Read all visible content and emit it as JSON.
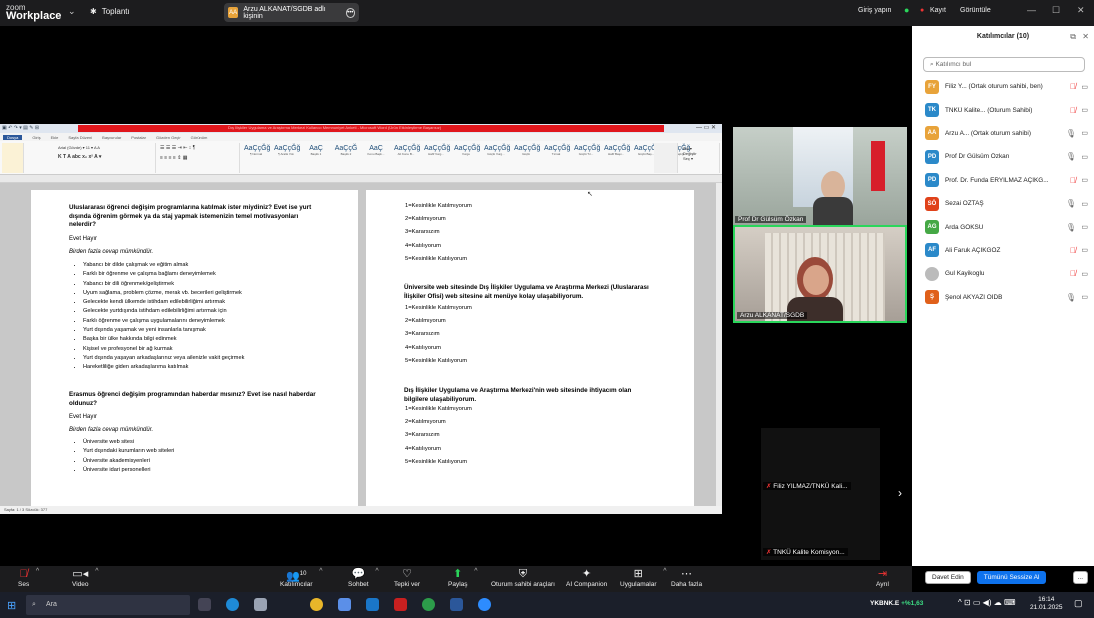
{
  "zoom": {
    "brand_line1": "zoom",
    "brand_line2": "Workplace",
    "meetings": "Toplantı",
    "share_pill": "Arzu ALKANAT/SGDB adlı kişinin",
    "share_initials": "AA",
    "sign_in": "Giriş yapın",
    "record": "Kayıt",
    "view": "Görüntüle"
  },
  "document": {
    "title": "Dış İlişkiler Uygulama ve Araştırma Merkezi Kullanıcı Memnuniyet Anketi - Microsoft Word (Ürün Etkinleştirme Başarısız)",
    "tabs": [
      "Dosya",
      "Giriş",
      "Ekle",
      "Sayfa Düzeni",
      "Başvurular",
      "Postalar",
      "Gözden Geçir",
      "Görünüm"
    ],
    "styles": [
      {
        "sample": "AaÇçĞğ",
        "name": "¶ Normal"
      },
      {
        "sample": "AaÇçĞğ",
        "name": "¶ Aralık Yok"
      },
      {
        "sample": "AaÇ",
        "name": "Başlık 1"
      },
      {
        "sample": "AaÇçĞ",
        "name": "Başlık 2"
      },
      {
        "sample": "AaÇ",
        "name": "Konu Başlı..."
      },
      {
        "sample": "AaÇçĞğ",
        "name": "Alt Konu B..."
      },
      {
        "sample": "AaÇçĞğ",
        "name": "Hafif Vurg..."
      },
      {
        "sample": "AaÇçĞğ",
        "name": "Vurgu"
      },
      {
        "sample": "AaÇçĞğ",
        "name": "Güçlü Vurg..."
      },
      {
        "sample": "AaÇçĞğ",
        "name": "Güçlü"
      },
      {
        "sample": "AaÇçĞğ",
        "name": "Tırnak"
      },
      {
        "sample": "AaÇçĞğ",
        "name": "Güçlü Tır..."
      },
      {
        "sample": "AaÇçĞğ",
        "name": "Hafif Başv..."
      },
      {
        "sample": "AaÇçĞğ",
        "name": "Güçlü Baş..."
      },
      {
        "sample": "AaÇçĞğ",
        "name": "Kitap Başlığı"
      }
    ],
    "status": "Sayfa: 1 / 3   Sözcük: 377",
    "page1": {
      "q1": "Uluslararası öğrenci değişim programlarına katılmak ister miydiniz? Evet ise yurt dışında öğrenim görmek ya da staj yapmak istemenizin temel motivasyonları nelerdir?",
      "yesno1": "Evet   Hayır",
      "multi1": "Birden fazla cevap mümkündür.",
      "bullets1": [
        "Yabancı bir dilde çalışmak ve eğitim almak",
        "Farklı bir öğrenme ve çalışma bağlamı deneyimlemek",
        "Yabancı bir dili öğrenmek/geliştirmek",
        "Uyum sağlama, problem çözme, merak vb. becerileri geliştirmek",
        "Gelecekte kendi ülkemde istihdam edilebilirliğimi artırmak",
        "Gelecekte yurtdışında istihdam edilebilirliğimi artırmak için",
        "Farklı öğrenme ve çalışma uygulamalarını deneyimlemek",
        "Yurt dışında yaşamak ve yeni insanlarla tanışmak",
        "Başka bir ülke hakkında bilgi edinmek",
        "Kişisel ve profesyonel bir ağ kurmak",
        "Yurt dışında yaşayan arkadaşlarınız veya ailenizle vakit geçirmek",
        "Hareketliliğe giden arkadaşlarıma katılmak"
      ],
      "q2": "Erasmus öğrenci değişim programından haberdar mısınız? Evet ise nasıl haberdar oldunuz?",
      "yesno2": "Evet   Hayır",
      "multi2": "Birden fazla cevap mümkündür.",
      "bullets2": [
        "Üniversite web sitesi",
        "Yurt dışındaki kurumların web siteleri",
        "Üniversite akademisyenleri",
        "Üniversite idari personelleri"
      ]
    },
    "page2": {
      "scale1": [
        "1=Kesinlikle Katılmıyorum",
        "2=Katılmıyorum",
        "3=Kararsızım",
        "4=Katılıyorum",
        "5=Kesinlikle Katılıyorum"
      ],
      "q3": "Üniversite web sitesinde Dış İlişkiler Uygulama ve Araştırma Merkezi (Uluslararası İlişkiler Ofisi) web sitesine ait menüye kolay ulaşabiliyorum.",
      "scale2": [
        "1=Kesinlikle Katılmıyorum",
        "2=Katılmıyorum",
        "3=Kararsızım",
        "4=Katılıyorum",
        "5=Kesinlikle Katılıyorum"
      ],
      "q4": "Dış İlişkiler Uygulama ve Araştırma Merkezi'nin web sitesinde ihtiyacım olan bilgilere ulaşabiliyorum.",
      "scale3": [
        "1=Kesinlikle Katılmıyorum",
        "2=Katılmıyorum",
        "3=Kararsızım",
        "4=Katılıyorum",
        "5=Kesinlikle Katılıyorum"
      ]
    }
  },
  "videos": {
    "cam1": "Prof Dr Gülsüm Özkan",
    "cam2": "Arzu ALKANAT/SGDB",
    "tile1": "Filiz YILMAZ/TNKÜ Kali...",
    "tile2": "TNKÜ Kalite Komisyon..."
  },
  "participants": {
    "title": "Katılımcılar (10)",
    "search_placeholder": "Katılımcı bul",
    "list": [
      {
        "initials": "FY",
        "name": "Filiz Y... (Ortak oturum sahibi, ben)",
        "color": "#e8a33a",
        "mic": "muted"
      },
      {
        "initials": "TK",
        "name": "TNKÜ Kalite... (Oturum Sahibi)",
        "color": "#2b89c9",
        "mic": "muted"
      },
      {
        "initials": "AA",
        "name": "Arzu A... (Ortak oturum sahibi)",
        "color": "#e8a33a",
        "mic": "on"
      },
      {
        "initials": "PD",
        "name": "Prof Dr Gülsüm Özkan",
        "color": "#2b89c9",
        "mic": "on"
      },
      {
        "initials": "PD",
        "name": "Prof. Dr. Funda ERYILMAZ AÇIKG...",
        "color": "#2b89c9",
        "mic": "muted"
      },
      {
        "initials": "SÖ",
        "name": "Sezai OZTAŞ",
        "color": "#e0421a",
        "mic": "on"
      },
      {
        "initials": "AG",
        "name": "Arda GÖKSU",
        "color": "#45a845",
        "mic": "on"
      },
      {
        "initials": "AF",
        "name": "Ali Faruk AÇIKGÖZ",
        "color": "#2b89c9",
        "mic": "muted"
      },
      {
        "initials": "",
        "name": "Gul Kayikoglu",
        "color": "#bbbbbb",
        "mic": "muted"
      },
      {
        "initials": "Ş",
        "name": "Şenol AKYAZI ÖİDB",
        "color": "#e0601a",
        "mic": "on"
      }
    ],
    "invite": "Davet Edin",
    "mute_all": "Tümünü Sessize Al",
    "more": "..."
  },
  "toolbar": {
    "audio": "Ses",
    "video": "Video",
    "participants": "Katılımcılar",
    "participants_count": "10",
    "chat": "Sohbet",
    "react": "Tepki ver",
    "share": "Paylaş",
    "host_tools": "Oturum sahibi araçları",
    "ai": "AI Companion",
    "apps": "Uygulamalar",
    "more": "Daha fazla",
    "leave": "Ayrıl"
  },
  "taskbar": {
    "search": "Ara",
    "stock": "YKBNK.E",
    "stock_change": "+%1,63",
    "time": "16:14",
    "date": "21.01.2025"
  }
}
